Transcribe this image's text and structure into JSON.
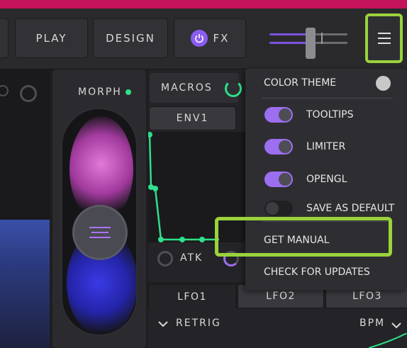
{
  "header": {
    "tabs": [
      {
        "label": "PLAY"
      },
      {
        "label": "DESIGN"
      },
      {
        "label": "FX"
      }
    ]
  },
  "morph": {
    "label": "MORPH",
    "indicator_color": "#2ee08a"
  },
  "macros": {
    "label": "MACROS"
  },
  "envelope": {
    "tab_label": "ENV1",
    "attack_label": "ATK"
  },
  "lfo": {
    "tabs": [
      {
        "label": "LFO1"
      },
      {
        "label": "LFO2"
      },
      {
        "label": "LFO3"
      }
    ],
    "retrig_label": "RETRIG",
    "bpm_label": "BPM"
  },
  "menu": {
    "color_theme": "COLOR THEME",
    "tooltips": "TOOLTIPS",
    "limiter": "LIMITER",
    "opengl": "OPENGL",
    "save_as_default": "SAVE AS DEFAULT",
    "get_manual": "GET MANUAL",
    "check_for_updates": "CHECK FOR UPDATES",
    "toggles": {
      "tooltips": true,
      "limiter": true,
      "opengl": true,
      "save_as_default": false
    }
  },
  "colors": {
    "accent": "#9c6ef0",
    "highlight": "#9ad33a",
    "envelope_line": "#2ee08a",
    "top_strip": "#c4135a"
  },
  "icons": {
    "menu": "hamburger-menu-icon",
    "power": "power-icon",
    "chevron": "chevron-down-icon"
  }
}
